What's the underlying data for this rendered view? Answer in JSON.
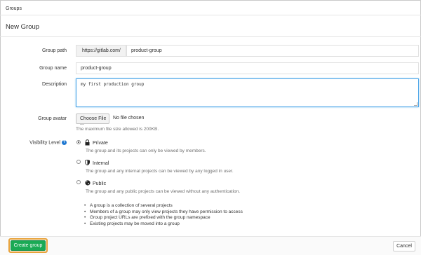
{
  "breadcrumb": "Groups",
  "page_title": "New Group",
  "form": {
    "group_path": {
      "label": "Group path",
      "prefix": "https://gitlab.com/",
      "value": "product-group"
    },
    "group_name": {
      "label": "Group name",
      "value": "product-group"
    },
    "description": {
      "label": "Description",
      "value": "my first production group"
    },
    "group_avatar": {
      "label": "Group avatar",
      "button": "Choose File ...",
      "status": "No file chosen",
      "hint": "The maximum file size allowed is 200KB."
    },
    "visibility": {
      "label": "Visibility Level",
      "help_icon": "?",
      "options": [
        {
          "icon": "lock-icon",
          "title": "Private",
          "description": "The group and its projects can only be viewed by members.",
          "selected": true
        },
        {
          "icon": "shield-icon",
          "title": "Internal",
          "description": "The group and any internal projects can be viewed by any logged in user.",
          "selected": false
        },
        {
          "icon": "globe-icon",
          "title": "Public",
          "description": "The group and any public projects can be viewed without any authentication.",
          "selected": false
        }
      ]
    },
    "info_bullets": [
      "A group is a collection of several projects",
      "Members of a group may only view projects they have permission to access",
      "Group project URLs are prefixed with the group namespace",
      "Existing projects may be moved into a group"
    ]
  },
  "footer": {
    "create_label": "Create group",
    "cancel_label": "Cancel",
    "create_color": "#1aaa55"
  }
}
